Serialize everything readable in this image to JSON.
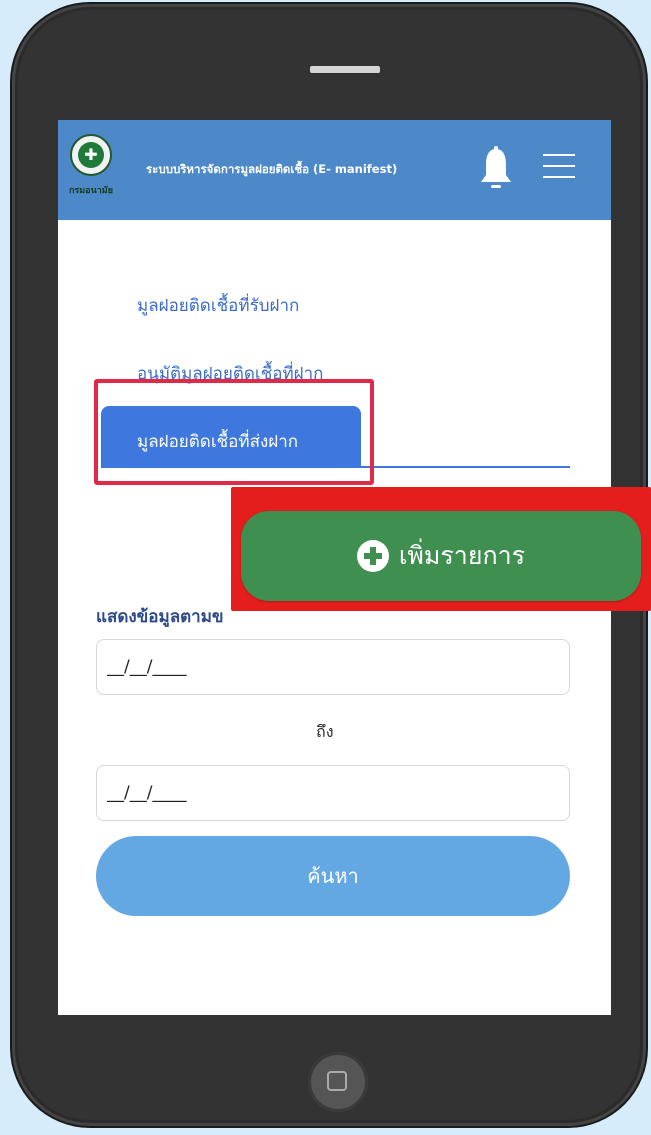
{
  "app": {
    "title": "ระบบบริหารจัดการมูลฝอยติดเชื้อ (E- manifest)",
    "logo_text": "กรมอนามัย"
  },
  "nav": {
    "received": "มูลฝอยติดเชื้อที่รับฝาก",
    "approve": "อนุมัติมูลฝอยติดเชื้อที่ฝาก",
    "sent_active_tab": "มูลฝอยติดเชื้อที่ส่งฝาก"
  },
  "actions": {
    "add_item": "เพิ่มรายการ",
    "search": "ค้นหา"
  },
  "filter": {
    "label": "แสดงข้อมูลตามข",
    "start_date_value": "__/__/____",
    "to_label": "ถึง",
    "end_date_value": "__/__/____"
  },
  "colors": {
    "appbar": "#4d89c8",
    "active_tab": "#3e78df",
    "add_button": "#3f8f51",
    "search_button": "#64a8e3",
    "highlight": "#e02a4a"
  }
}
